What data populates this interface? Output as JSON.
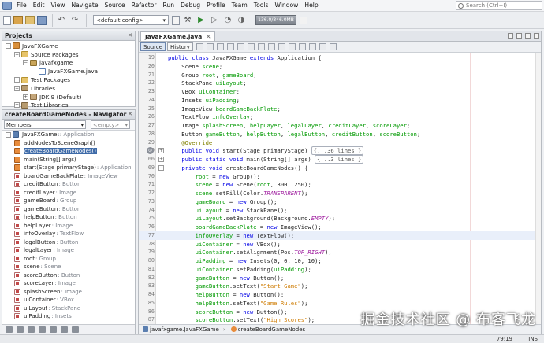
{
  "menu": {
    "items": [
      "File",
      "Edit",
      "View",
      "Navigate",
      "Source",
      "Refactor",
      "Run",
      "Debug",
      "Profile",
      "Team",
      "Tools",
      "Window",
      "Help"
    ],
    "search_placeholder": "Search (Ctrl+I)"
  },
  "toolbar": {
    "config": "<default config>",
    "memory": "136.0/346.0MB"
  },
  "projects": {
    "title": "Projects",
    "close": "✕",
    "tree": [
      {
        "label": "JavaFXGame",
        "icon": "project-icon",
        "indent": 0,
        "expander": "−"
      },
      {
        "label": "Source Packages",
        "icon": "folder-icon",
        "indent": 1,
        "expander": "−"
      },
      {
        "label": "javafxgame",
        "icon": "package-icon",
        "indent": 2,
        "expander": "−"
      },
      {
        "label": "JavaFXGame.java",
        "icon": "java-file-icon",
        "indent": 3,
        "expander": ""
      },
      {
        "label": "Test Packages",
        "icon": "folder-icon",
        "indent": 1,
        "expander": "+"
      },
      {
        "label": "Libraries",
        "icon": "library-icon",
        "indent": 1,
        "expander": "−"
      },
      {
        "label": "JDK 9 (Default)",
        "icon": "jar-icon",
        "indent": 2,
        "expander": "+"
      },
      {
        "label": "Test Libraries",
        "icon": "library-icon",
        "indent": 1,
        "expander": "+"
      }
    ]
  },
  "navigator": {
    "title": "createBoardGameNodes - Navigator",
    "close": "✕",
    "filter": "Members",
    "scope": "<empty>",
    "class_name": "JavaFXGame",
    "class_type": ":: Application",
    "members": [
      {
        "name": "addNodesToSceneGraph()",
        "type": "",
        "kind": "method"
      },
      {
        "name": "createBoardGameNodes()",
        "type": "",
        "kind": "method",
        "selected": true
      },
      {
        "name": "main(String[] args)",
        "type": "",
        "kind": "method"
      },
      {
        "name": "start(Stage primaryStage)",
        "type": " : Application",
        "kind": "method"
      },
      {
        "name": "boardGameBackPlate",
        "type": " : ImageView",
        "kind": "field"
      },
      {
        "name": "creditButton",
        "type": " : Button",
        "kind": "field"
      },
      {
        "name": "creditLayer",
        "type": " : Image",
        "kind": "field"
      },
      {
        "name": "gameBoard",
        "type": " : Group",
        "kind": "field"
      },
      {
        "name": "gameButton",
        "type": " : Button",
        "kind": "field"
      },
      {
        "name": "helpButton",
        "type": " : Button",
        "kind": "field"
      },
      {
        "name": "helpLayer",
        "type": " : Image",
        "kind": "field"
      },
      {
        "name": "infoOverlay",
        "type": " : TextFlow",
        "kind": "field"
      },
      {
        "name": "legalButton",
        "type": " : Button",
        "kind": "field"
      },
      {
        "name": "legalLayer",
        "type": " : Image",
        "kind": "field"
      },
      {
        "name": "root",
        "type": " : Group",
        "kind": "field"
      },
      {
        "name": "scene",
        "type": " : Scene",
        "kind": "field"
      },
      {
        "name": "scoreButton",
        "type": " : Button",
        "kind": "field"
      },
      {
        "name": "scoreLayer",
        "type": " : Image",
        "kind": "field"
      },
      {
        "name": "splashScreen",
        "type": " : Image",
        "kind": "field"
      },
      {
        "name": "uiContainer",
        "type": " : VBox",
        "kind": "field"
      },
      {
        "name": "uiLayout",
        "type": " : StackPane",
        "kind": "field"
      },
      {
        "name": "uiPadding",
        "type": " : Insets",
        "kind": "field"
      }
    ]
  },
  "editor": {
    "tab": "JavaFXGame.java",
    "tab_close": "✕",
    "modes": [
      "Source",
      "History"
    ],
    "lines": [
      {
        "n": "19",
        "text": "public class JavaFXGame extends Application {"
      },
      {
        "n": "20",
        "text": "    Scene scene;"
      },
      {
        "n": "21",
        "text": "    Group root, gameBoard;"
      },
      {
        "n": "22",
        "text": "    StackPane uiLayout;"
      },
      {
        "n": "23",
        "text": "    VBox uiContainer;"
      },
      {
        "n": "24",
        "text": "    Insets uiPadding;"
      },
      {
        "n": "25",
        "text": "    ImageView boardGameBackPlate;"
      },
      {
        "n": "26",
        "text": "    TextFlow infoOverlay;"
      },
      {
        "n": "27",
        "text": "    Image splashScreen, helpLayer, legalLayer, creditLayer, scoreLayer;"
      },
      {
        "n": "28",
        "text": "    Button gameButton, helpButton, legalButton, creditButton, scoreButton;"
      },
      {
        "n": "29",
        "text": "    @Override"
      },
      {
        "n": "30",
        "text": "    public void start(Stage primaryStage) ",
        "collapsed": "{...36 lines }",
        "fold": "+",
        "override": true
      },
      {
        "n": "66",
        "text": "    public static void main(String[] args) ",
        "collapsed": "{...3 lines }",
        "fold": "+"
      },
      {
        "n": "69",
        "text": "    private void createBoardGameNodes() {",
        "fold": "−"
      },
      {
        "n": "70",
        "text": "        root = new Group();"
      },
      {
        "n": "71",
        "text": "        scene = new Scene(root, 300, 250);"
      },
      {
        "n": "72",
        "text": "        scene.setFill(Color.TRANSPARENT);"
      },
      {
        "n": "73",
        "text": "        gameBoard = new Group();"
      },
      {
        "n": "74",
        "text": "        uiLayout = new StackPane();"
      },
      {
        "n": "75",
        "text": "        uiLayout.setBackground(Background.EMPTY);"
      },
      {
        "n": "76",
        "text": "        boardGameBackPlate = new ImageView();"
      },
      {
        "n": "77",
        "text": "        infoOverlay = new TextFlow();",
        "highlight": true
      },
      {
        "n": "78",
        "text": "        uiContainer = new VBox();"
      },
      {
        "n": "79",
        "text": "        uiContainer.setAlignment(Pos.TOP_RIGHT);"
      },
      {
        "n": "80",
        "text": "        uiPadding = new Insets(0, 0, 10, 10);"
      },
      {
        "n": "81",
        "text": "        uiContainer.setPadding(uiPadding);"
      },
      {
        "n": "82",
        "text": "        gameButton = new Button();"
      },
      {
        "n": "83",
        "text": "        gameButton.setText(\"Start Game\");"
      },
      {
        "n": "84",
        "text": "        helpButton = new Button();"
      },
      {
        "n": "85",
        "text": "        helpButton.setText(\"Game Rules\");"
      },
      {
        "n": "86",
        "text": "        scoreButton = new Button();"
      },
      {
        "n": "87",
        "text": "        scoreButton.setText(\"High Scores\");"
      }
    ],
    "breadcrumbs": [
      "javafxgame.JavaFXGame",
      "createBoardGameNodes"
    ]
  },
  "status": {
    "position": "79:19",
    "mode": "INS"
  },
  "watermark": "掘金技术社区 @ 布客飞龙",
  "colors": {
    "keyword": "#0000e6",
    "string": "#ce7b00",
    "annotation": "#808000",
    "field": "#009900",
    "constant": "#9e1b9e",
    "highlight": "#e9effa"
  }
}
